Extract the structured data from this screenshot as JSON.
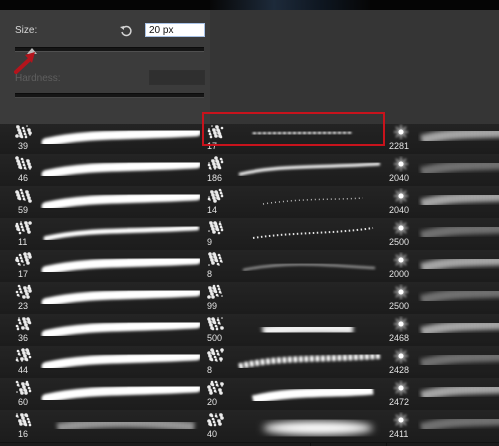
{
  "brush_panel": {
    "size_label": "Size:",
    "size_value": "20 px",
    "size_slider_fraction": 0.09,
    "hardness_label": "Hardness:",
    "hardness_value": ""
  },
  "brush_grid": {
    "columns": [
      {
        "sizes": [
          "39",
          "46",
          "59",
          "11",
          "17",
          "23",
          "36",
          "44",
          "60",
          "16"
        ]
      },
      {
        "sizes": [
          "17",
          "186",
          "14",
          "9",
          "8",
          "99",
          "500",
          "8",
          "20",
          "40"
        ]
      },
      {
        "sizes": [
          "2281",
          "2040",
          "2040",
          "2500",
          "2000",
          "2500",
          "2468",
          "2428",
          "2472",
          "2411"
        ]
      }
    ],
    "selected": {
      "column": 1,
      "row": 4
    }
  },
  "colors": {
    "panel_bg": "#3b3b3b",
    "grid_bg": "#1b1b1b",
    "selection_red": "#c8131c",
    "arrow_red": "#b4141c"
  }
}
